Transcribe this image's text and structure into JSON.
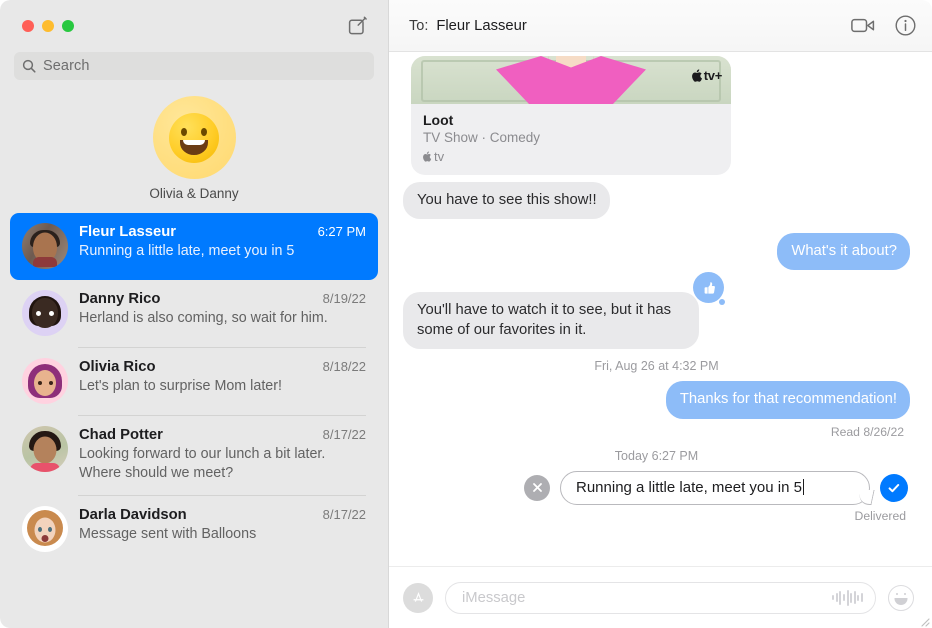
{
  "window": {
    "traffic_lights": {
      "close_color": "#ff5f57",
      "minimize_color": "#febc2e",
      "zoom_color": "#28c840"
    }
  },
  "sidebar": {
    "compose_icon": "compose-pencil-square-icon",
    "search": {
      "placeholder": "Search",
      "icon": "search-icon"
    },
    "pinned": {
      "avatar_icon": "grinning-face-emoji",
      "name": "Olivia & Danny"
    },
    "conversations": [
      {
        "name": "Fleur Lasseur",
        "time": "6:27 PM",
        "snippet": "Running a little late, meet you in 5",
        "avatar": "photo-avatar-fleur",
        "selected": true
      },
      {
        "name": "Danny Rico",
        "time": "8/19/22",
        "snippet": "Herland is also coming, so wait for him.",
        "avatar": "memoji-avatar-danny",
        "selected": false
      },
      {
        "name": "Olivia Rico",
        "time": "8/18/22",
        "snippet": "Let's plan to surprise Mom later!",
        "avatar": "memoji-avatar-olivia",
        "selected": false
      },
      {
        "name": "Chad Potter",
        "time": "8/17/22",
        "snippet": "Looking forward to our lunch a bit later. Where should we meet?",
        "avatar": "photo-avatar-chad",
        "selected": false
      },
      {
        "name": "Darla Davidson",
        "time": "8/17/22",
        "snippet": "Message sent with Balloons",
        "avatar": "memoji-avatar-darla",
        "selected": false
      }
    ],
    "selection_color": "#007aff",
    "background_color": "#e8e8e8"
  },
  "chat": {
    "header": {
      "to_label": "To:",
      "recipient": "Fleur Lasseur",
      "facetime_icon": "video-camera-icon",
      "info_icon": "info-circle-icon"
    },
    "link_card": {
      "title": "Loot",
      "subtitle": "TV Show · Comedy",
      "app_name": "tv",
      "app_icon": "apple-logo-icon",
      "badge": "tv+",
      "badge_icon": "apple-tv-plus-badge"
    },
    "messages": [
      {
        "id": "msg-see-show",
        "side": "left",
        "text": "You have to see this show!!"
      },
      {
        "id": "msg-whats-it-about",
        "side": "right",
        "text": "What's it about?"
      },
      {
        "id": "msg-watch-to-see",
        "side": "left",
        "text": "You'll have to watch it to see, but it has some of our favorites in it.",
        "reaction": "thumbs-up-reaction"
      },
      {
        "id": "msg-thanks",
        "side": "right",
        "text": "Thanks for that recommendation!"
      }
    ],
    "timestamp_aug26": "Fri, Aug 26 at 4:32 PM",
    "read_receipt": "Read 8/26/22",
    "timestamp_today": "Today 6:27 PM",
    "editing": {
      "value": "Running a little late, meet you in 5",
      "cancel_icon": "close-x-icon",
      "confirm_icon": "checkmark-icon",
      "confirm_color": "#007aff",
      "delivery_status": "Delivered"
    },
    "composer": {
      "appstore_icon": "app-store-icon",
      "placeholder": "iMessage",
      "audio_icon": "audio-waveform-icon",
      "emoji_icon": "smiley-face-icon"
    },
    "bubble_colors": {
      "incoming": "#e9e9eb",
      "outgoing": "#8dbcf8"
    }
  }
}
